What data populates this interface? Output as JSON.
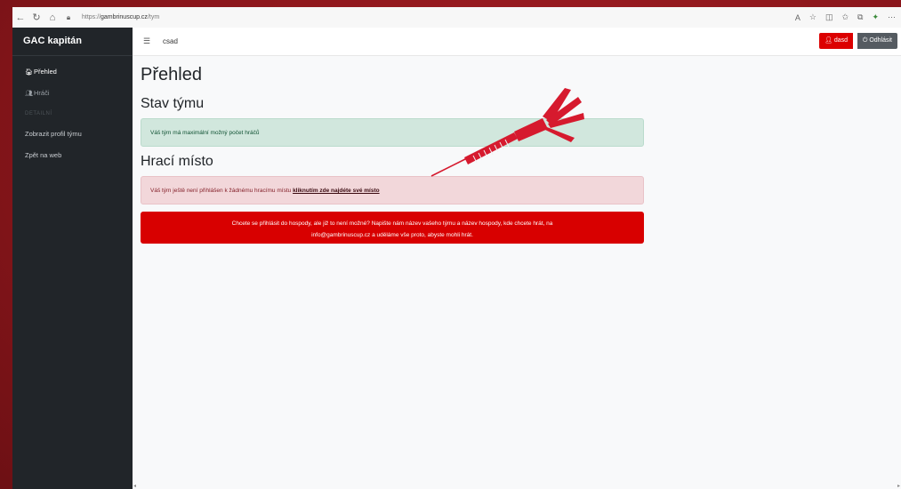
{
  "browser": {
    "url_prefix": "https://",
    "url_domain": "gambrinuscup.cz",
    "url_path": "/tym"
  },
  "sidebar": {
    "brand": "GAC kapitán",
    "items": [
      {
        "label": "Přehled",
        "icon": "home-icon",
        "active": true
      },
      {
        "label": "Hráči",
        "icon": "users-icon",
        "active": false
      }
    ],
    "section_heading": "DETAILNÍ",
    "links": [
      "Zobrazit profil týmu",
      "Zpět na web"
    ]
  },
  "topbar": {
    "team_name": "csad",
    "user_button": "dasd",
    "logout_button": "Odhlásit"
  },
  "main": {
    "page_title": "Přehled",
    "team_status": {
      "heading": "Stav týmu",
      "message": "Váš tým má maximální možný počet hráčů"
    },
    "venue": {
      "heading": "Hrací místo",
      "message": "Váš tým ještě není přihlášen k žádnému hracímu místu",
      "link": "kliknutím zde najdéte své místo"
    },
    "contact_notice": {
      "line1": "Chcete se přihlásit do hospody, ale již to není možné? Napište nám název vašeho týmu a název hospody, kde chcete hrát, na",
      "line2": "info@gambrinuscup.cz a uděláme vše proto, abyste mohli hrát."
    }
  },
  "colors": {
    "background": "#8e1a1f",
    "sidebar": "#212529",
    "accent_red": "#dc0000",
    "success_bg": "#d1e7dd",
    "danger_bg": "#f2d7da"
  }
}
